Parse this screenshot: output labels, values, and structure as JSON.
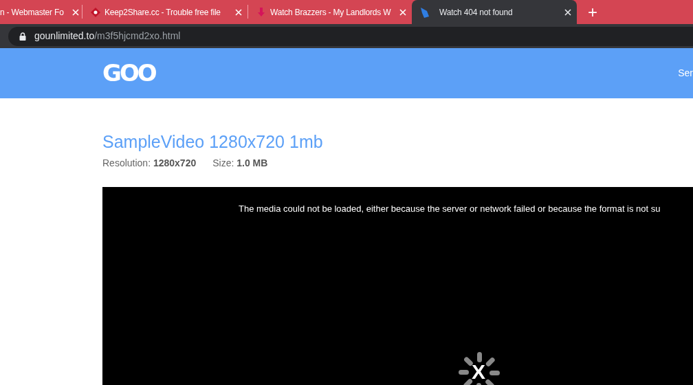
{
  "tabs": [
    {
      "title": "n - Webmaster Fo",
      "selected": false
    },
    {
      "title": "Keep2Share.cc - Trouble free file",
      "selected": false
    },
    {
      "title": "Watch Brazzers - My Landlords W",
      "selected": false
    },
    {
      "title": "Watch 404 not found",
      "selected": true
    }
  ],
  "new_tab": "+",
  "address_bar": {
    "domain": "gounlimited.to",
    "path": "/m3f5hjcmd2xo.html"
  },
  "header": {
    "logo": "GOO",
    "nav_item": "Ser"
  },
  "video": {
    "title": "SampleVideo 1280x720 1mb",
    "resolution_label": "Resolution:",
    "resolution": "1280x720",
    "size_label": "Size:",
    "size": "1.0 MB",
    "error": "The media could not be loaded, either because the server or network failed or because the format is not su",
    "spinner_mark": "X"
  }
}
